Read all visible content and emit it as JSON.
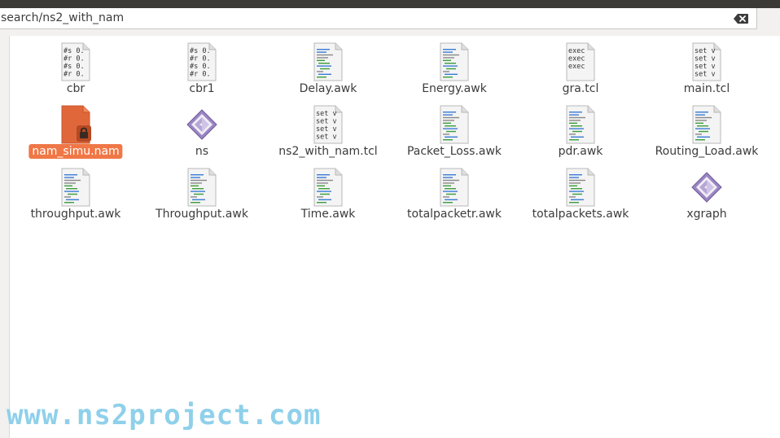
{
  "location": {
    "path": "search/ns2_with_nam"
  },
  "files": [
    {
      "name": "cbr",
      "type": "text-numeric",
      "preview": [
        "#s 0.",
        "#r 0.",
        "#s 0.",
        "#r 0."
      ]
    },
    {
      "name": "cbr1",
      "type": "text-numeric",
      "preview": [
        "#s 0.",
        "#r 0.",
        "#s 0.",
        "#r 0."
      ]
    },
    {
      "name": "Delay.awk",
      "type": "script"
    },
    {
      "name": "Energy.awk",
      "type": "script"
    },
    {
      "name": "gra.tcl",
      "type": "text-preview",
      "preview": [
        "exec",
        "exec",
        "exec"
      ]
    },
    {
      "name": "main.tcl",
      "type": "text-preview",
      "preview": [
        "set v",
        "set v",
        "set v",
        "set v"
      ]
    },
    {
      "name": "nam_simu.nam",
      "type": "locked",
      "selected": true
    },
    {
      "name": "ns",
      "type": "executable"
    },
    {
      "name": "ns2_with_nam.tcl",
      "type": "text-preview",
      "preview": [
        "set v",
        "set v",
        "set v",
        "set v"
      ]
    },
    {
      "name": "Packet_Loss.awk",
      "type": "script"
    },
    {
      "name": "pdr.awk",
      "type": "script"
    },
    {
      "name": "Routing_Load.awk",
      "type": "script"
    },
    {
      "name": "throughput.awk",
      "type": "script"
    },
    {
      "name": "Throughput.awk",
      "type": "script"
    },
    {
      "name": "Time.awk",
      "type": "script"
    },
    {
      "name": "totalpacketr.awk",
      "type": "script"
    },
    {
      "name": "totalpackets.awk",
      "type": "script"
    },
    {
      "name": "xgraph",
      "type": "executable"
    }
  ],
  "watermark": "www.ns2project.com",
  "colors": {
    "selection": "#f07746",
    "watermark": "#8fd0ea",
    "executable": "#9b86c3"
  }
}
